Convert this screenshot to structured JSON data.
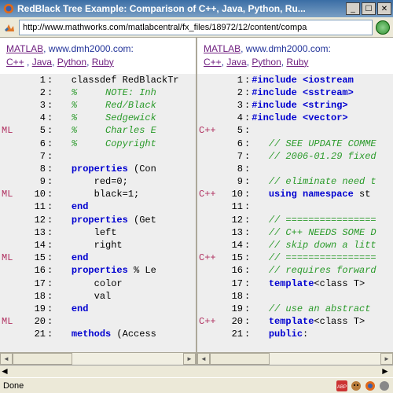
{
  "window": {
    "title": "RedBlack Tree Example: Comparison of C++, Java, Python, Ru..."
  },
  "url": "http://www.mathworks.com/matlabcentral/fx_files/18972/12/content/compa",
  "header": {
    "site_label": "MATLAB",
    "site_suffix": ", www.dmh2000.com:",
    "lang1": "C++",
    "lang2": "Java",
    "lang3": "Python",
    "lang4": "Ruby"
  },
  "left": {
    "mark_label": "ML",
    "lines": [
      {
        "n": 1,
        "m": "",
        "kind": "plain",
        "text": "classdef RedBlackTr"
      },
      {
        "n": 2,
        "m": "",
        "kind": "comment",
        "text": "%     NOTE: Inh"
      },
      {
        "n": 3,
        "m": "",
        "kind": "comment",
        "text": "%     Red/Black"
      },
      {
        "n": 4,
        "m": "",
        "kind": "comment",
        "text": "%     Sedgewick"
      },
      {
        "n": 5,
        "m": "ML",
        "kind": "comment",
        "text": "%     Charles E"
      },
      {
        "n": 6,
        "m": "",
        "kind": "comment",
        "text": "%     Copyright"
      },
      {
        "n": 7,
        "m": "",
        "kind": "plain",
        "text": ""
      },
      {
        "n": 8,
        "m": "",
        "kind": "kw",
        "text": "properties",
        "tail": " (Con"
      },
      {
        "n": 9,
        "m": "",
        "kind": "plain",
        "text": "    red=0;"
      },
      {
        "n": 10,
        "m": "ML",
        "kind": "plain",
        "text": "    black=1;"
      },
      {
        "n": 11,
        "m": "",
        "kind": "kw",
        "text": "end"
      },
      {
        "n": 12,
        "m": "",
        "kind": "kw",
        "text": "properties",
        "tail": " (Get"
      },
      {
        "n": 13,
        "m": "",
        "kind": "plain",
        "text": "    left"
      },
      {
        "n": 14,
        "m": "",
        "kind": "plain",
        "text": "    right"
      },
      {
        "n": 15,
        "m": "ML",
        "kind": "kw",
        "text": "end"
      },
      {
        "n": 16,
        "m": "",
        "kind": "kw",
        "text": "properties",
        "tail": " % Le"
      },
      {
        "n": 17,
        "m": "",
        "kind": "plain",
        "text": "    color"
      },
      {
        "n": 18,
        "m": "",
        "kind": "plain",
        "text": "    val"
      },
      {
        "n": 19,
        "m": "",
        "kind": "kw",
        "text": "end"
      },
      {
        "n": 20,
        "m": "ML",
        "kind": "plain",
        "text": ""
      },
      {
        "n": 21,
        "m": "",
        "kind": "kw",
        "text": "methods",
        "tail": " (Access"
      }
    ]
  },
  "right": {
    "mark_label": "C++",
    "lines": [
      {
        "n": 1,
        "m": "",
        "kind": "inc",
        "pre": "#include ",
        "arg": "<iostream"
      },
      {
        "n": 2,
        "m": "",
        "kind": "inc",
        "pre": "#include ",
        "arg": "<sstream>"
      },
      {
        "n": 3,
        "m": "",
        "kind": "inc",
        "pre": "#include ",
        "arg": "<string>"
      },
      {
        "n": 4,
        "m": "",
        "kind": "inc",
        "pre": "#include ",
        "arg": "<vector>"
      },
      {
        "n": 5,
        "m": "C++",
        "kind": "plain",
        "text": ""
      },
      {
        "n": 6,
        "m": "",
        "kind": "comment",
        "text": "// SEE UPDATE COMME"
      },
      {
        "n": 7,
        "m": "",
        "kind": "comment",
        "text": "// 2006-01.29 fixed"
      },
      {
        "n": 8,
        "m": "",
        "kind": "plain",
        "text": ""
      },
      {
        "n": 9,
        "m": "",
        "kind": "comment",
        "text": "// eliminate need t"
      },
      {
        "n": 10,
        "m": "C++",
        "kind": "kw",
        "text": "using namespace",
        "tail": " st"
      },
      {
        "n": 11,
        "m": "",
        "kind": "plain",
        "text": ""
      },
      {
        "n": 12,
        "m": "",
        "kind": "comment",
        "text": "// ================"
      },
      {
        "n": 13,
        "m": "",
        "kind": "comment",
        "text": "// C++ NEEDS SOME D"
      },
      {
        "n": 14,
        "m": "",
        "kind": "comment",
        "text": "// skip down a litt"
      },
      {
        "n": 15,
        "m": "C++",
        "kind": "comment",
        "text": "// ================"
      },
      {
        "n": 16,
        "m": "",
        "kind": "comment",
        "text": "// requires forward"
      },
      {
        "n": 17,
        "m": "",
        "kind": "kw",
        "text": "template",
        "tail": "<class T>"
      },
      {
        "n": 18,
        "m": "",
        "kind": "plain",
        "text": ""
      },
      {
        "n": 19,
        "m": "",
        "kind": "comment",
        "text": "// use an abstract "
      },
      {
        "n": 20,
        "m": "C++",
        "kind": "kw",
        "text": "template",
        "tail": "<class T>"
      },
      {
        "n": 21,
        "m": "",
        "kind": "kw",
        "text": "public",
        "tail": ":"
      }
    ]
  },
  "status": {
    "text": "Done"
  }
}
